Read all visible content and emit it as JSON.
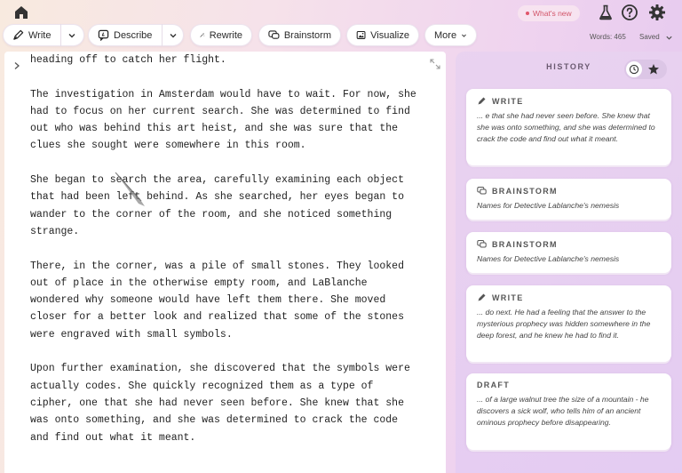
{
  "topbar": {
    "whats_new": "What's new"
  },
  "toolbar": {
    "write": "Write",
    "describe": "Describe",
    "rewrite": "Rewrite",
    "brainstorm": "Brainstorm",
    "visualize": "Visualize",
    "more": "More",
    "word_count": "Words: 465",
    "save_status": "Saved"
  },
  "document": {
    "paragraphs": [
      "heading off to catch her flight.",
      "The investigation in Amsterdam would have to wait. For now, she\nhad to focus on her current search. She was determined to find\nout who was behind this art heist, and she was sure that the\nclues she sought were somewhere in this room.",
      "She began to search the area, carefully examining each object\nthat had been left behind. As she searched, her eyes began to\nwander to the corner of the room, and she noticed something\nstrange.",
      "There, in the corner, was a pile of small stones. They looked\nout of place in the otherwise empty room, and LaBlanche\nwondered why someone would have left them there. She moved\ncloser for a better look and realized that some of the stones\nwere engraved with small symbols.",
      "Upon further examination, she discovered that the symbols were\nactually codes. She quickly recognized them as a type of\ncipher, one that she had never seen before. She knew that she\nwas onto something, and she was determined to crack the code\nand find out what it meant."
    ]
  },
  "history": {
    "title": "HISTORY",
    "cards": [
      {
        "type": "WRITE",
        "text": "... e that she had never seen before. She knew that she was onto something, and she was determined to crack the code and find out what it meant."
      },
      {
        "type": "BRAINSTORM",
        "text": "Names for Detective Lablanche's nemesis"
      },
      {
        "type": "BRAINSTORM",
        "text": "Names for Detective Lablanche's nemesis"
      },
      {
        "type": "WRITE",
        "text": "... do next. He had a feeling that the answer to the mysterious prophecy was hidden somewhere in the deep forest, and he knew he had to find it."
      },
      {
        "type": "DRAFT",
        "text": "... of a large walnut tree the size of a mountain - he discovers a sick wolf, who tells him of an ancient ominous prophecy before disappearing."
      }
    ]
  }
}
